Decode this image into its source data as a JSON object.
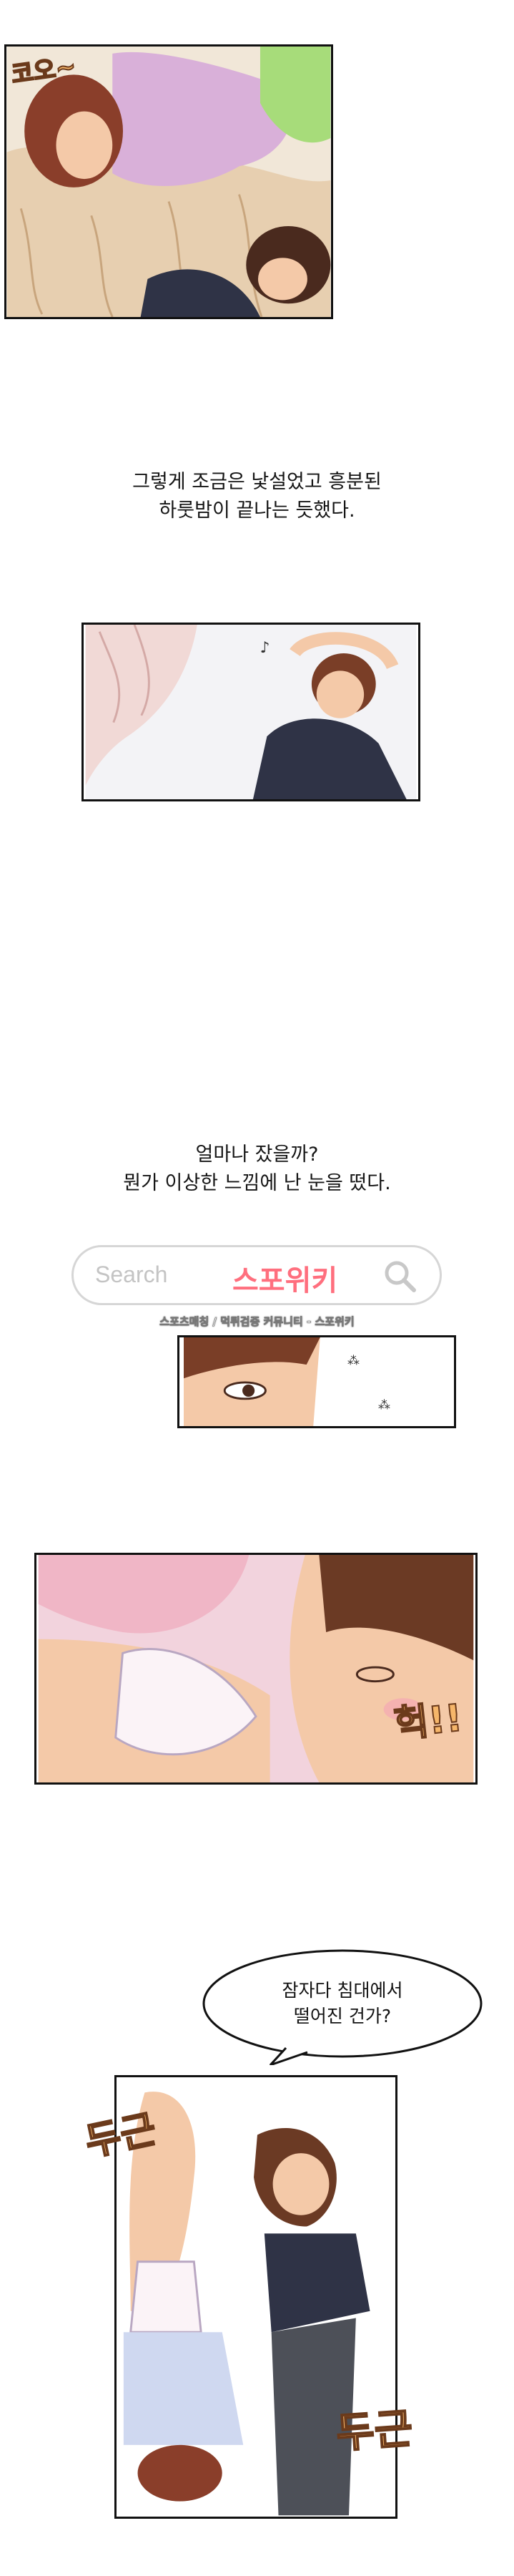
{
  "narration": {
    "block1": {
      "line1": "그렇게 조금은 낯설었고 흥분된",
      "line2": "하룻밤이 끝나는 듯했다."
    },
    "block2": {
      "line1": "얼마나 잤을까?",
      "line2": "뭔가 이상한 느낌에 난 눈을 떴다."
    }
  },
  "search": {
    "placeholder": "Search",
    "brand": "스포위키",
    "caption": "스포츠매칭 / 먹튀검증 커뮤니티 - 스포위키",
    "icon": "magnifier-icon"
  },
  "sfx": {
    "snore": "코오~",
    "gasp": "헉!!",
    "thump1": "두근",
    "thump2": "두근"
  },
  "speech_bubble": {
    "line1": "잠자다 침대에서",
    "line2": "떨어진 건가?"
  },
  "colors": {
    "panel_border": "#111111",
    "skin": "#f4c9a8",
    "hair_brown": "#6b3a24",
    "shirt_dark": "#2f3346",
    "blanket": "#e9d3b6",
    "pink_fabric": "#f2b8cf",
    "sfx_fill": "#f6b66a",
    "brand_pink": "#ff6f7e"
  }
}
